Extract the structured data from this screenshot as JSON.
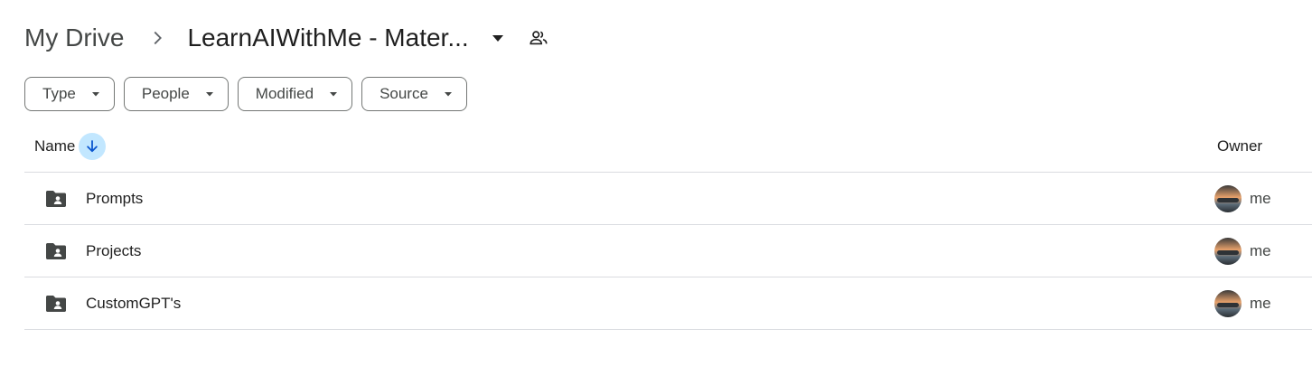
{
  "breadcrumb": {
    "root": "My Drive",
    "current": "LearnAIWithMe - Mater..."
  },
  "filters": [
    {
      "label": "Type"
    },
    {
      "label": "People"
    },
    {
      "label": "Modified"
    },
    {
      "label": "Source"
    }
  ],
  "table": {
    "columns": {
      "name": "Name",
      "owner": "Owner"
    },
    "sort": {
      "column": "Name",
      "direction": "descending"
    },
    "rows": [
      {
        "name": "Prompts",
        "owner": "me",
        "icon": "shared-folder-icon"
      },
      {
        "name": "Projects",
        "owner": "me",
        "icon": "shared-folder-icon"
      },
      {
        "name": "CustomGPT's",
        "owner": "me",
        "icon": "shared-folder-icon"
      }
    ]
  },
  "colors": {
    "sort_highlight": "#c2e7ff",
    "sort_arrow": "#0b57d0",
    "divider": "#dadce0",
    "chip_border": "#747775",
    "folder": "#444746"
  }
}
